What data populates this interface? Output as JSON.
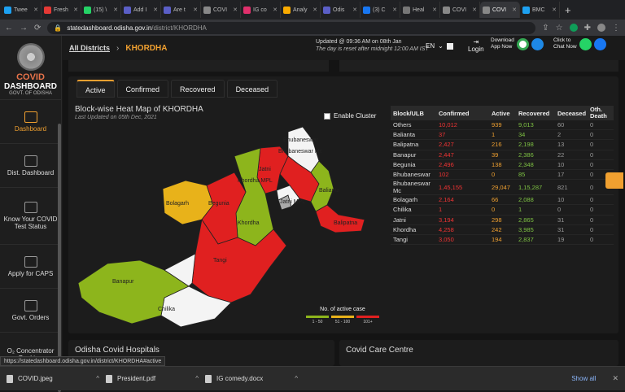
{
  "browser": {
    "tabs": [
      {
        "label": "Twee",
        "color": "#1da1f2"
      },
      {
        "label": "Fresh",
        "color": "#e53935"
      },
      {
        "label": "(15) \\",
        "color": "#25d366"
      },
      {
        "label": "Add I",
        "color": "#5b5fc7"
      },
      {
        "label": "Are t",
        "color": "#5b5fc7"
      },
      {
        "label": "COVI",
        "color": "#888888"
      },
      {
        "label": "IG co",
        "color": "#e1306c"
      },
      {
        "label": "Analy",
        "color": "#f9ab00"
      },
      {
        "label": "Odis",
        "color": "#5b5fc7"
      },
      {
        "label": "(3) C",
        "color": "#1877f2"
      },
      {
        "label": "Heal",
        "color": "#777777"
      },
      {
        "label": "COVI",
        "color": "#888888"
      },
      {
        "label": "COVI",
        "color": "#888888",
        "active": true
      },
      {
        "label": "BMC",
        "color": "#1da1f2"
      }
    ],
    "new_tab": "+",
    "url_domain": "statedashboard.odisha.gov.in",
    "url_path": "/district/KHORDHA"
  },
  "sidebar": {
    "title1": "COVID",
    "title2": "DASHBOARD",
    "title3": "GOVT. OF ODISHA",
    "items": [
      {
        "label": "Dashboard"
      },
      {
        "label": "Dist. Dashboard"
      },
      {
        "label": "Know Your COVID Test Status"
      },
      {
        "label": "Apply for CAPS"
      },
      {
        "label": "Govt. Orders"
      },
      {
        "label": "O₂ Concentrator Booking"
      }
    ]
  },
  "topbar": {
    "crumb_all": "All Districts",
    "crumb_sep": "›",
    "crumb_district": "KHORDHA",
    "updated": "Updated @ 09:36 AM on 08th Jan",
    "reset": "The day is reset after midnight 12:00 AM IST",
    "lang": "EN",
    "login": "Login",
    "download1": "Download",
    "download2": "App Now",
    "chat1": "Click to",
    "chat2": "Chat Now"
  },
  "card": {
    "tabs": [
      "Active",
      "Confirmed",
      "Recovered",
      "Deceased"
    ],
    "map_title": "Block-wise Heat Map of KHORDHA",
    "map_sub": "Last Updated on 05th Dec, 2021",
    "cluster": "Enable Cluster",
    "legend_title": "No. of active case",
    "legend": [
      {
        "label": "1 - 50",
        "color": "#8db51c"
      },
      {
        "label": "51 - 100",
        "color": "#e8b21a"
      },
      {
        "label": "101+",
        "color": "#e02020"
      }
    ],
    "map_labels": {
      "bhub": "Bhubaneswar",
      "bhubmc": "Bhubaneswar Mc",
      "balianta": "Balianta",
      "jatni": "Jatni",
      "khordhampl": "Khordha MPL",
      "jatnimpl": "Jatni MPL",
      "bolagarh": "Bolagarh",
      "begunia": "Begunia",
      "khordha": "Khordha",
      "balipatna": "Balipatna",
      "tangi": "Tangi",
      "banapur": "Banapur",
      "chilika": "Chilika"
    },
    "table_headers": [
      "Block/ULB",
      "Confirmed",
      "Active",
      "Recovered",
      "Deceased",
      "Oth. Death"
    ],
    "rows": [
      [
        "Others",
        "10,012",
        "939",
        "9,013",
        "60",
        "0"
      ],
      [
        "Balianta",
        "37",
        "1",
        "34",
        "2",
        "0"
      ],
      [
        "Balipatna",
        "2,427",
        "216",
        "2,198",
        "13",
        "0"
      ],
      [
        "Banapur",
        "2,447",
        "39",
        "2,386",
        "22",
        "0"
      ],
      [
        "Begunia",
        "2,496",
        "138",
        "2,348",
        "10",
        "0"
      ],
      [
        "Bhubaneswar",
        "102",
        "0",
        "85",
        "17",
        "0"
      ],
      [
        "Bhubaneswar Mc",
        "1,45,155",
        "29,047",
        "1,15,287",
        "821",
        "0"
      ],
      [
        "Bolagarh",
        "2,164",
        "66",
        "2,088",
        "10",
        "0"
      ],
      [
        "Chilika",
        "1",
        "0",
        "1",
        "0",
        "0"
      ],
      [
        "Jatni",
        "3,194",
        "298",
        "2,865",
        "31",
        "0"
      ],
      [
        "Khordha",
        "4,258",
        "242",
        "3,985",
        "31",
        "0"
      ],
      [
        "Tangi",
        "3,050",
        "194",
        "2,837",
        "19",
        "0"
      ]
    ]
  },
  "sections": {
    "hospitals": "Odisha Covid Hospitals",
    "care": "Covid Care Centre"
  },
  "status_url": "https://statedashboard.odisha.gov.in/district/KHORDHA#active",
  "downloads": {
    "items": [
      "COVID.jpeg",
      "President.pdf",
      "IG comedy.docx"
    ],
    "show_all": "Show all",
    "caret": "^",
    "close": "✕"
  }
}
